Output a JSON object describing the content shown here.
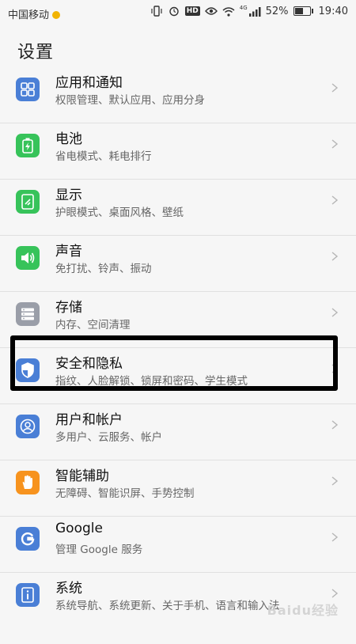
{
  "status_bar": {
    "carrier": "中国移动",
    "hd_label": "HD",
    "network_label": "4G",
    "battery": "52%",
    "battery_level": 0.52,
    "time": "19:40"
  },
  "page": {
    "title": "设置"
  },
  "colors": {
    "blue": "#4a7fd6",
    "green": "#37c35a",
    "gray": "#9a9ea8",
    "orange": "#f7931e",
    "highlight": "#000000"
  },
  "items": [
    {
      "title": "应用和通知",
      "subtitle": "权限管理、默认应用、应用分身",
      "icon": "apps-grid-icon"
    },
    {
      "title": "电池",
      "subtitle": "省电模式、耗电排行",
      "icon": "battery-icon"
    },
    {
      "title": "显示",
      "subtitle": "护眼模式、桌面风格、壁纸",
      "icon": "display-icon"
    },
    {
      "title": "声音",
      "subtitle": "免打扰、铃声、振动",
      "icon": "speaker-icon"
    },
    {
      "title": "存储",
      "subtitle": "内存、空间清理",
      "icon": "storage-icon"
    },
    {
      "title": "安全和隐私",
      "subtitle": "指纹、人脸解锁、锁屏和密码、学生模式",
      "icon": "shield-icon"
    },
    {
      "title": "用户和帐户",
      "subtitle": "多用户、云服务、帐户",
      "icon": "user-icon"
    },
    {
      "title": "智能辅助",
      "subtitle": "无障碍、智能识屏、手势控制",
      "icon": "hand-icon"
    },
    {
      "title": "Google",
      "subtitle": "管理 Google 服务",
      "icon": "google-icon"
    },
    {
      "title": "系统",
      "subtitle": "系统导航、系统更新、关于手机、语言和输入法",
      "icon": "info-icon"
    }
  ],
  "watermark": "Baidu经验"
}
